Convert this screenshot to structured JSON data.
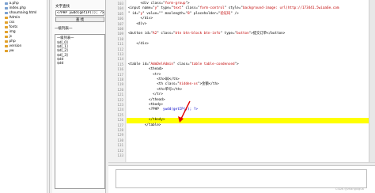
{
  "sidebar": {
    "items": [
      {
        "label": "a.php",
        "kind": "file"
      },
      {
        "label": "index.php",
        "kind": "file"
      },
      {
        "label": "shoumaing.html",
        "kind": "file"
      },
      {
        "label": "Admin",
        "kind": "folder"
      },
      {
        "label": "css",
        "kind": "folder"
      },
      {
        "label": "fonts",
        "kind": "folder"
      },
      {
        "label": "img",
        "kind": "folder"
      },
      {
        "label": "js",
        "kind": "folder"
      },
      {
        "label": "php",
        "kind": "folder"
      },
      {
        "label": "version",
        "kind": "folder"
      },
      {
        "label": "yw",
        "kind": "folder"
      }
    ]
  },
  "query_panel": {
    "section_label": "文字查找",
    "input_value": "<?PHP ywdd(getIP()); ?>",
    "button_label": "查 找",
    "list_section_label": "一级列表一",
    "list_header": "一级列表一",
    "list_items": [
      "$d[_0]",
      "$d[_1]",
      "$d[_2]",
      "$d[_3]",
      "$dd",
      "$dd"
    ]
  },
  "editor": {
    "lines": [
      {
        "n": "103",
        "segs": [
          {
            "t": "      <div class=\"",
            "c": ""
          },
          {
            "t": "form-group",
            "c": "str"
          },
          {
            "t": "\">",
            "c": ""
          }
        ]
      },
      {
        "n": "104",
        "segs": [
          {
            "t": "<input name=\"",
            "c": ""
          },
          {
            "t": "y",
            "c": "str"
          },
          {
            "t": "\" type=\"",
            "c": ""
          },
          {
            "t": "text",
            "c": "str"
          },
          {
            "t": "\" class=\"",
            "c": ""
          },
          {
            "t": "form-control",
            "c": "str"
          },
          {
            "t": "\" style=\"",
            "c": ""
          },
          {
            "t": "background-image: url(http://173441.5wiaa6e.com",
            "c": "str"
          }
        ]
      },
      {
        "n": "105",
        "segs": [
          {
            "t": "\" id=\"",
            "c": ""
          },
          {
            "t": "y",
            "c": "str"
          },
          {
            "t": "\" value=\"",
            "c": ""
          },
          {
            "t": "\" maxlength=\"",
            "c": ""
          },
          {
            "t": "8",
            "c": "str"
          },
          {
            "t": "\" placeholder=\"",
            "c": ""
          },
          {
            "t": "验证码",
            "c": "str"
          },
          {
            "t": "\" />",
            "c": ""
          }
        ]
      },
      {
        "n": "106",
        "segs": [
          {
            "t": "      </div>",
            "c": ""
          }
        ]
      },
      {
        "n": "107",
        "segs": [
          {
            "t": "    <div>",
            "c": ""
          }
        ]
      },
      {
        "n": "108",
        "segs": [
          {
            "t": "",
            "c": ""
          }
        ]
      },
      {
        "n": "109",
        "segs": [
          {
            "t": "<button id=\"",
            "c": ""
          },
          {
            "t": "A2",
            "c": "str"
          },
          {
            "t": "\" class=\"",
            "c": ""
          },
          {
            "t": "btn btn-block btn-info",
            "c": "str"
          },
          {
            "t": "\" type=\"",
            "c": ""
          },
          {
            "t": "button",
            "c": "str"
          },
          {
            "t": "\">提交订单</button>",
            "c": ""
          }
        ]
      },
      {
        "n": "110",
        "segs": [
          {
            "t": "",
            "c": ""
          }
        ]
      },
      {
        "n": "111",
        "segs": [
          {
            "t": "    </div>",
            "c": ""
          }
        ]
      },
      {
        "n": "112",
        "segs": [
          {
            "t": "",
            "c": ""
          }
        ]
      },
      {
        "n": "113",
        "segs": [
          {
            "t": "",
            "c": ""
          }
        ]
      },
      {
        "n": "114",
        "segs": [
          {
            "t": "",
            "c": ""
          }
        ]
      },
      {
        "n": "115",
        "segs": [
          {
            "t": "<table id=\"",
            "c": ""
          },
          {
            "t": "AdmDelAdmin",
            "c": "str"
          },
          {
            "t": "\" class=\"",
            "c": ""
          },
          {
            "t": "table table-condensed",
            "c": "str"
          },
          {
            "t": "\">",
            "c": ""
          }
        ]
      },
      {
        "n": "116",
        "segs": [
          {
            "t": "          <thead>",
            "c": ""
          }
        ]
      },
      {
        "n": "117",
        "segs": [
          {
            "t": "            <tr>",
            "c": ""
          }
        ]
      },
      {
        "n": "118",
        "segs": [
          {
            "t": "              <th>QQ</th>",
            "c": ""
          }
        ]
      },
      {
        "n": "119",
        "segs": [
          {
            "t": "              <th class=\"",
            "c": ""
          },
          {
            "t": "hidden-xs",
            "c": "str"
          },
          {
            "t": "\">金额</th>",
            "c": ""
          }
        ]
      },
      {
        "n": "120",
        "segs": [
          {
            "t": "              <th>单号</th>",
            "c": ""
          }
        ]
      },
      {
        "n": "121",
        "segs": [
          {
            "t": "            </tr>",
            "c": ""
          }
        ]
      },
      {
        "n": "122",
        "segs": [
          {
            "t": "          </thead>",
            "c": ""
          }
        ]
      },
      {
        "n": "123",
        "segs": [
          {
            "t": "          <tbody>",
            "c": ""
          }
        ]
      },
      {
        "n": "124",
        "segs": [
          {
            "t": "          <?PHP  ",
            "c": ""
          },
          {
            "t": "ywdd(getIP()); ?>",
            "c": "kw"
          }
        ]
      },
      {
        "n": "125",
        "segs": [
          {
            "t": "",
            "c": ""
          }
        ]
      },
      {
        "n": "126",
        "segs": [
          {
            "t": "          </tbody>",
            "c": ""
          }
        ]
      },
      {
        "n": "127",
        "segs": [
          {
            "t": "        </table>",
            "c": ""
          }
        ]
      },
      {
        "n": "128",
        "segs": [
          {
            "t": "",
            "c": ""
          }
        ]
      },
      {
        "n": "129",
        "segs": [
          {
            "t": "",
            "c": ""
          }
        ]
      },
      {
        "n": "130",
        "segs": [
          {
            "t": "",
            "c": ""
          }
        ]
      },
      {
        "n": "131",
        "segs": [
          {
            "t": "",
            "c": ""
          }
        ]
      },
      {
        "n": "132",
        "segs": [
          {
            "t": "",
            "c": ""
          }
        ]
      },
      {
        "n": "133",
        "segs": [
          {
            "t": "",
            "c": ""
          }
        ]
      }
    ],
    "highlighted_line": "126"
  },
  "watermark": "CSDN @zhangxigua",
  "colors": {
    "highlight": "#ffff00",
    "string": "#c00000",
    "keyword": "#0000c8",
    "folder": "#e2a12a",
    "annotation_arrow": "#e00000"
  }
}
